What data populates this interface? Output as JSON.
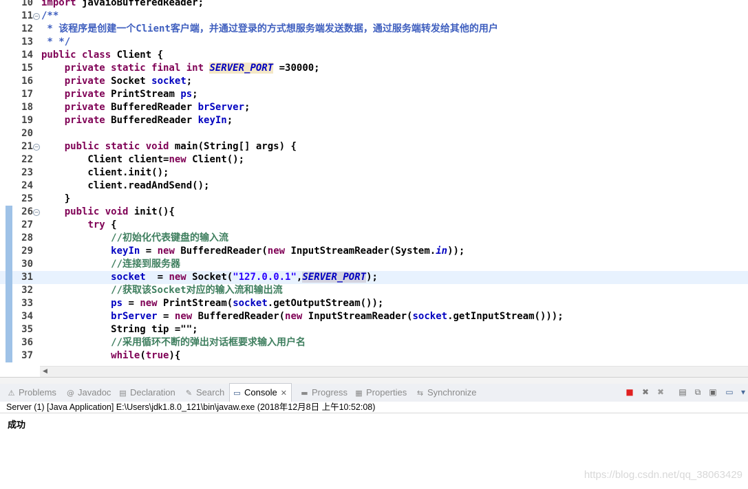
{
  "editor": {
    "lines": [
      {
        "n": "10",
        "segs": [
          {
            "c": "kw",
            "t": "import"
          },
          {
            "t": " javaioBufferedReader;"
          }
        ],
        "mark": false,
        "fold": false
      },
      {
        "n": "11",
        "segs": [
          {
            "c": "jd",
            "t": "/**"
          }
        ],
        "mark": false,
        "fold": true
      },
      {
        "n": "12",
        "segs": [
          {
            "c": "jd",
            "t": " * 该程序是创建一个Client客户端，并通过登录的方式想服务端发送数据，通过服务端转发给其他的用户"
          }
        ],
        "mark": false,
        "fold": false
      },
      {
        "n": "13",
        "segs": [
          {
            "c": "jd",
            "t": " * */"
          }
        ],
        "mark": false,
        "fold": false
      },
      {
        "n": "14",
        "segs": [
          {
            "c": "kw",
            "t": "public class"
          },
          {
            "t": " Client {"
          }
        ],
        "mark": false,
        "fold": false
      },
      {
        "n": "15",
        "segs": [
          {
            "t": "    "
          },
          {
            "c": "kw",
            "t": "private static final int"
          },
          {
            "t": " "
          },
          {
            "c": "sf hl",
            "t": "SERVER_PORT"
          },
          {
            "t": " =30000;"
          }
        ],
        "mark": false,
        "fold": false
      },
      {
        "n": "16",
        "segs": [
          {
            "t": "    "
          },
          {
            "c": "kw",
            "t": "private"
          },
          {
            "t": " Socket "
          },
          {
            "c": "fld",
            "t": "socket"
          },
          {
            "t": ";"
          }
        ],
        "mark": false,
        "fold": false
      },
      {
        "n": "17",
        "segs": [
          {
            "t": "    "
          },
          {
            "c": "kw",
            "t": "private"
          },
          {
            "t": " PrintStream "
          },
          {
            "c": "fld",
            "t": "ps"
          },
          {
            "t": ";"
          }
        ],
        "mark": false,
        "fold": false
      },
      {
        "n": "18",
        "segs": [
          {
            "t": "    "
          },
          {
            "c": "kw",
            "t": "private"
          },
          {
            "t": " BufferedReader "
          },
          {
            "c": "fld",
            "t": "brServer"
          },
          {
            "t": ";"
          }
        ],
        "mark": false,
        "fold": false
      },
      {
        "n": "19",
        "segs": [
          {
            "t": "    "
          },
          {
            "c": "kw",
            "t": "private"
          },
          {
            "t": " BufferedReader "
          },
          {
            "c": "fld",
            "t": "keyIn"
          },
          {
            "t": ";"
          }
        ],
        "mark": false,
        "fold": false
      },
      {
        "n": "20",
        "segs": [],
        "mark": false,
        "fold": false
      },
      {
        "n": "21",
        "segs": [
          {
            "t": "    "
          },
          {
            "c": "kw",
            "t": "public static void"
          },
          {
            "t": " main(String[] args) {"
          }
        ],
        "mark": false,
        "fold": true
      },
      {
        "n": "22",
        "segs": [
          {
            "t": "        Client client="
          },
          {
            "c": "kw",
            "t": "new"
          },
          {
            "t": " Client();"
          }
        ],
        "mark": false,
        "fold": false
      },
      {
        "n": "23",
        "segs": [
          {
            "t": "        client.init();"
          }
        ],
        "mark": false,
        "fold": false
      },
      {
        "n": "24",
        "segs": [
          {
            "t": "        client.readAndSend();"
          }
        ],
        "mark": false,
        "fold": false
      },
      {
        "n": "25",
        "segs": [
          {
            "t": "    }"
          }
        ],
        "mark": false,
        "fold": false
      },
      {
        "n": "26",
        "segs": [
          {
            "t": "    "
          },
          {
            "c": "kw",
            "t": "public void"
          },
          {
            "t": " init(){"
          }
        ],
        "mark": true,
        "fold": true
      },
      {
        "n": "27",
        "segs": [
          {
            "t": "        "
          },
          {
            "c": "kw",
            "t": "try"
          },
          {
            "t": " {"
          }
        ],
        "mark": true,
        "fold": false
      },
      {
        "n": "28",
        "segs": [
          {
            "t": "            "
          },
          {
            "c": "cm",
            "t": "//初始化代表键盘的输入流"
          }
        ],
        "mark": true,
        "fold": false
      },
      {
        "n": "29",
        "segs": [
          {
            "t": "            "
          },
          {
            "c": "fld",
            "t": "keyIn"
          },
          {
            "t": " = "
          },
          {
            "c": "kw",
            "t": "new"
          },
          {
            "t": " BufferedReader("
          },
          {
            "c": "kw",
            "t": "new"
          },
          {
            "t": " InputStreamReader(System."
          },
          {
            "c": "sf",
            "t": "in"
          },
          {
            "t": "));"
          }
        ],
        "mark": true,
        "fold": false
      },
      {
        "n": "30",
        "segs": [
          {
            "t": "            "
          },
          {
            "c": "cm",
            "t": "//连接到服务器"
          }
        ],
        "mark": true,
        "fold": false
      },
      {
        "n": "31",
        "segs": [
          {
            "t": "            "
          },
          {
            "c": "fld",
            "t": "socket"
          },
          {
            "t": "  = "
          },
          {
            "c": "kw",
            "t": "new"
          },
          {
            "t": " Socket("
          },
          {
            "c": "str",
            "t": "\"127.0.0.1\""
          },
          {
            "t": ","
          },
          {
            "c": "sf hl2",
            "t": "SERVER_"
          },
          {
            "c": "caret",
            "t": ""
          },
          {
            "c": "sf hl2",
            "t": "PORT"
          },
          {
            "t": ");"
          }
        ],
        "mark": true,
        "fold": false,
        "current": true
      },
      {
        "n": "32",
        "segs": [
          {
            "t": "            "
          },
          {
            "c": "cm",
            "t": "//获取该Socket对应的输入流和输出流"
          }
        ],
        "mark": true,
        "fold": false
      },
      {
        "n": "33",
        "segs": [
          {
            "t": "            "
          },
          {
            "c": "fld",
            "t": "ps"
          },
          {
            "t": " = "
          },
          {
            "c": "kw",
            "t": "new"
          },
          {
            "t": " PrintStream("
          },
          {
            "c": "fld",
            "t": "socket"
          },
          {
            "t": ".getOutputStream());"
          }
        ],
        "mark": true,
        "fold": false
      },
      {
        "n": "34",
        "segs": [
          {
            "t": "            "
          },
          {
            "c": "fld",
            "t": "brServer"
          },
          {
            "t": " = "
          },
          {
            "c": "kw",
            "t": "new"
          },
          {
            "t": " BufferedReader("
          },
          {
            "c": "kw",
            "t": "new"
          },
          {
            "t": " InputStreamReader("
          },
          {
            "c": "fld",
            "t": "socket"
          },
          {
            "t": ".getInputStream()));"
          }
        ],
        "mark": true,
        "fold": false
      },
      {
        "n": "35",
        "segs": [
          {
            "t": "            String tip =\"\";"
          }
        ],
        "mark": true,
        "fold": false
      },
      {
        "n": "36",
        "segs": [
          {
            "t": "            "
          },
          {
            "c": "cm",
            "t": "//采用循环不断的弹出对话框要求输入用户名"
          }
        ],
        "mark": true,
        "fold": false
      },
      {
        "n": "37",
        "segs": [
          {
            "t": "            "
          },
          {
            "c": "kw",
            "t": "while"
          },
          {
            "t": "("
          },
          {
            "c": "kw",
            "t": "true"
          },
          {
            "t": "){"
          }
        ],
        "mark": true,
        "fold": false
      }
    ]
  },
  "views": {
    "tabs": [
      {
        "label": "Problems",
        "icon": "problems-icon",
        "glyph": "⚠",
        "active": false
      },
      {
        "label": "Javadoc",
        "icon": "javadoc-icon",
        "glyph": "@",
        "active": false
      },
      {
        "label": "Declaration",
        "icon": "declaration-icon",
        "glyph": "▤",
        "active": false
      },
      {
        "label": "Search",
        "icon": "search-icon",
        "glyph": "✎",
        "active": false
      },
      {
        "label": "Console",
        "icon": "console-icon",
        "glyph": "▭",
        "active": true
      },
      {
        "label": "Progress",
        "icon": "progress-icon",
        "glyph": "▬",
        "active": false
      },
      {
        "label": "Properties",
        "icon": "properties-icon",
        "glyph": "▦",
        "active": false
      },
      {
        "label": "Synchronize",
        "icon": "synchronize-icon",
        "glyph": "⇆",
        "active": false
      }
    ],
    "toolbar": [
      {
        "name": "terminate-icon",
        "glyph": "■",
        "color": "#e02020"
      },
      {
        "name": "remove-launch-icon",
        "glyph": "✖",
        "color": "#7a7a7a"
      },
      {
        "name": "remove-all-terminated-icon",
        "glyph": "✖",
        "color": "#9a9a9a"
      },
      {
        "name": "clear-console-icon",
        "glyph": "▤",
        "color": "#6a6a6a"
      },
      {
        "name": "scroll-lock-icon",
        "glyph": "⧉",
        "color": "#6a6a6a"
      },
      {
        "name": "word-wrap-icon",
        "glyph": "▣",
        "color": "#6a6a6a"
      },
      {
        "name": "display-selected-console-icon",
        "glyph": "▭",
        "color": "#4a6a9a"
      },
      {
        "name": "open-console-icon",
        "glyph": "▾",
        "color": "#4a6a9a"
      }
    ],
    "console_title": "Server (1) [Java Application] E:\\Users\\jdk1.8.0_121\\bin\\javaw.exe (2018年12月8日 上午10:52:08)",
    "output": "成功",
    "watermark": "https://blog.csdn.net/qq_38063429"
  }
}
